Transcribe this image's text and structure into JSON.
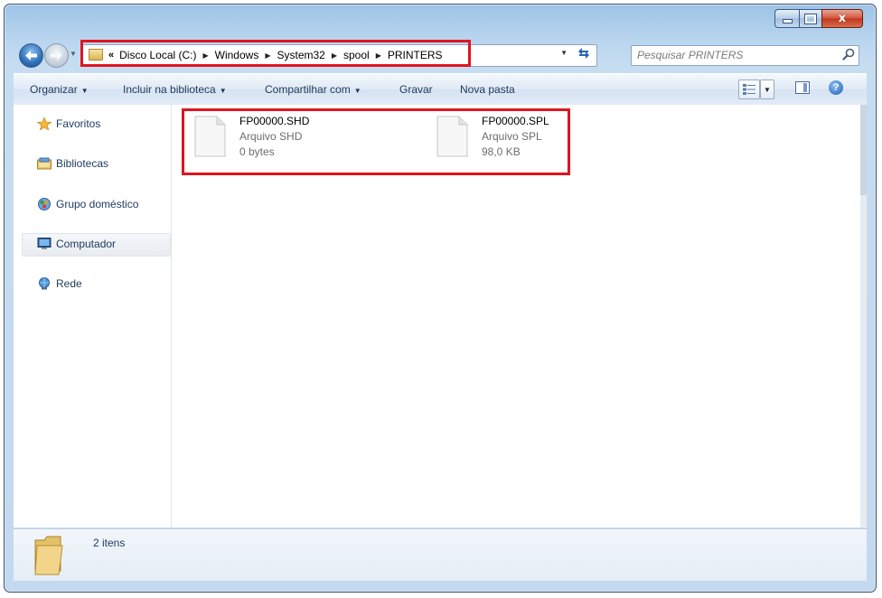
{
  "window": {
    "minimize_label": "",
    "maximize_label": "",
    "close_label": "x"
  },
  "address_bar": {
    "overflow": "«",
    "crumbs": [
      "Disco Local (C:)",
      "Windows",
      "System32",
      "spool",
      "PRINTERS"
    ]
  },
  "search": {
    "placeholder": "Pesquisar PRINTERS"
  },
  "toolbar": {
    "organizar": "Organizar",
    "incluir": "Incluir na biblioteca",
    "compartilhar": "Compartilhar com",
    "gravar": "Gravar",
    "nova_pasta": "Nova pasta",
    "help": "?"
  },
  "nav_pane": {
    "items": [
      {
        "label": "Favoritos",
        "icon": "star-icon"
      },
      {
        "label": "Bibliotecas",
        "icon": "libraries-icon"
      },
      {
        "label": "Grupo doméstico",
        "icon": "homegroup-icon"
      },
      {
        "label": "Computador",
        "icon": "computer-icon",
        "selected": true
      },
      {
        "label": "Rede",
        "icon": "network-icon"
      }
    ]
  },
  "files": [
    {
      "name": "FP00000.SHD",
      "type": "Arquivo SHD",
      "size": "0 bytes"
    },
    {
      "name": "FP00000.SPL",
      "type": "Arquivo SPL",
      "size": "98,0 KB"
    }
  ],
  "details": {
    "count": "2 itens"
  },
  "colors": {
    "highlight": "#e0141e",
    "link_text": "#1e395b",
    "meta_text": "#6d6d6d"
  }
}
